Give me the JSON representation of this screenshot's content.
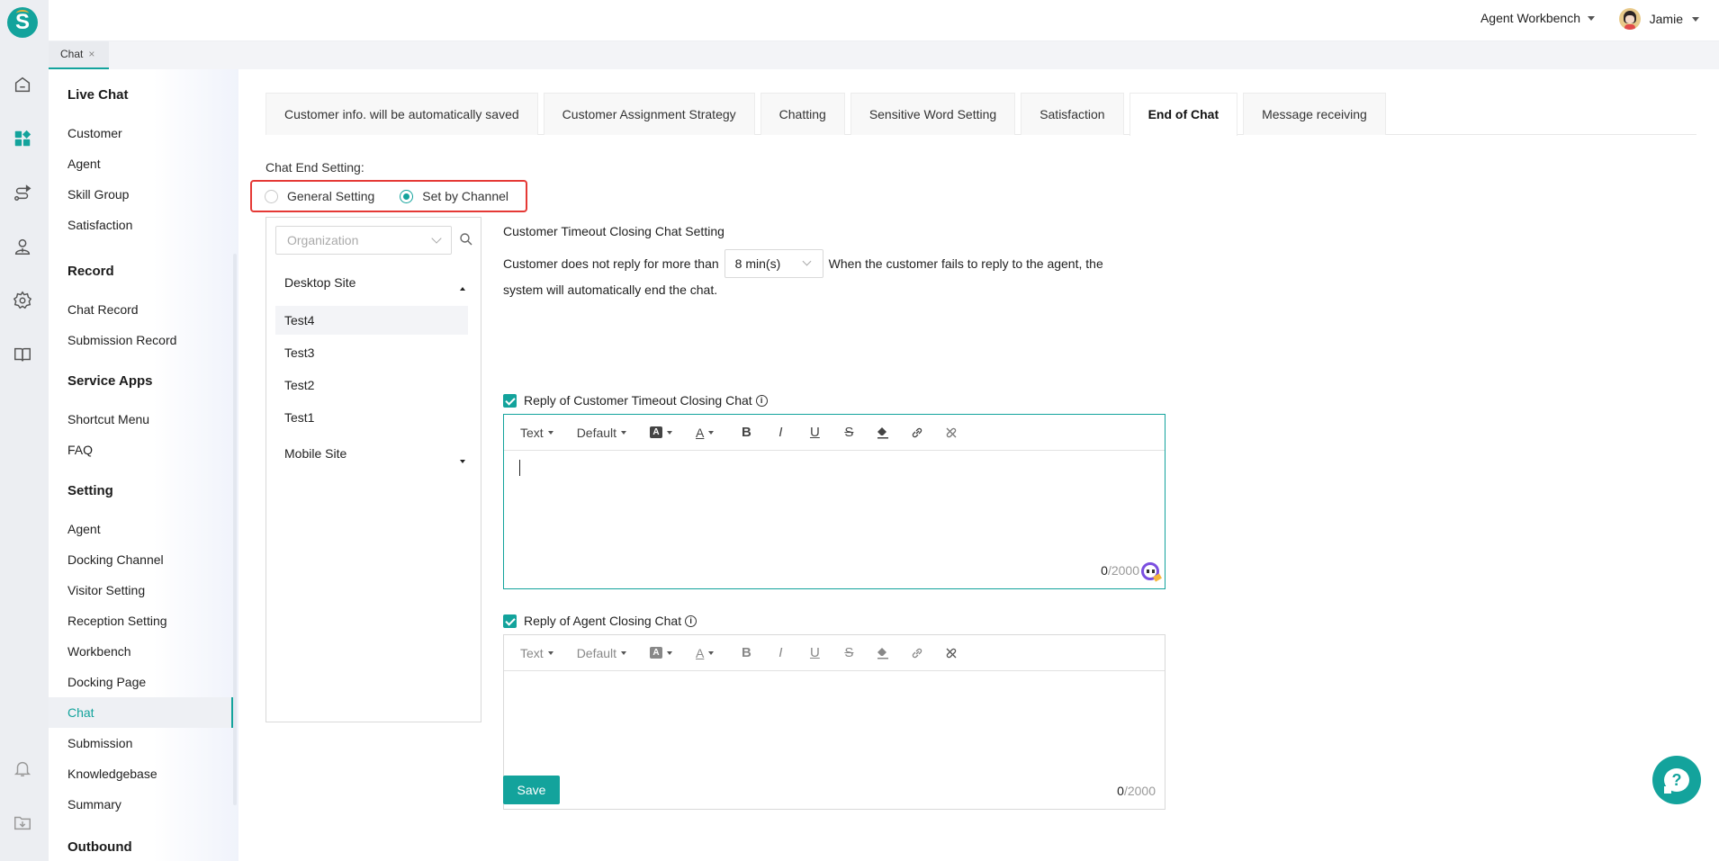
{
  "app": {
    "brand_letter": "S",
    "accent_color": "#13a39c",
    "highlight_color": "#e53935"
  },
  "rail": {
    "icons": [
      "home-icon",
      "dashboard-icon",
      "route-icon",
      "agent-icon",
      "settings-icon",
      "book-icon",
      "bell-icon",
      "download-folder-icon"
    ]
  },
  "topbar": {
    "workbench_label": "Agent Workbench",
    "user_name": "Jamie"
  },
  "tabstrip": {
    "tabs": [
      {
        "label": "Chat",
        "close": "×"
      }
    ]
  },
  "sidebar": {
    "groups": [
      {
        "title": "Live Chat",
        "items": [
          "Customer",
          "Agent",
          "Skill Group",
          "Satisfaction"
        ]
      },
      {
        "title": "Record",
        "items": [
          "Chat Record",
          "Submission Record"
        ]
      },
      {
        "title": "Service Apps",
        "items": [
          "Shortcut Menu",
          "FAQ"
        ]
      },
      {
        "title": "Setting",
        "items": [
          "Agent",
          "Docking Channel",
          "Visitor Setting",
          "Reception Setting",
          "Workbench",
          "Docking Page",
          "Chat",
          "Submission",
          "Knowledgebase",
          "Summary"
        ]
      },
      {
        "title": "Outbound",
        "items": []
      }
    ],
    "active_item": "Chat"
  },
  "main": {
    "tabs": [
      {
        "label": "Customer info. will be automatically saved"
      },
      {
        "label": "Customer Assignment Strategy"
      },
      {
        "label": "Chatting"
      },
      {
        "label": "Sensitive Word Setting"
      },
      {
        "label": "Satisfaction"
      },
      {
        "label": "End of Chat",
        "active": true
      },
      {
        "label": "Message receiving"
      }
    ],
    "chat_end_label": "Chat End Setting:",
    "radios": [
      {
        "label": "General Setting",
        "checked": false
      },
      {
        "label": "Set by Channel",
        "checked": true
      }
    ],
    "org": {
      "placeholder": "Organization",
      "sites": [
        {
          "name": "Desktop Site",
          "expanded": true,
          "channels": [
            "Test4",
            "Test3",
            "Test2",
            "Test1"
          ],
          "active": "Test4"
        },
        {
          "name": "Mobile Site",
          "expanded": false
        }
      ]
    },
    "timeout": {
      "title": "Customer Timeout Closing Chat Setting",
      "prefix": "Customer does not reply for more than",
      "value": "8 min(s)",
      "suffix": "When the customer fails to reply to the agent, the",
      "suffix2": "system will automatically end the chat."
    },
    "editors": [
      {
        "label": "Reply of Customer Timeout Closing Chat",
        "checked": true,
        "count": "0",
        "max": "/2000",
        "toolbar": {
          "text": "Text",
          "font": "Default"
        }
      },
      {
        "label": "Reply of Agent Closing Chat",
        "checked": true,
        "count": "0",
        "max": "/2000",
        "toolbar": {
          "text": "Text",
          "font": "Default"
        }
      }
    ],
    "save_label": "Save",
    "help_glyph": "?"
  }
}
